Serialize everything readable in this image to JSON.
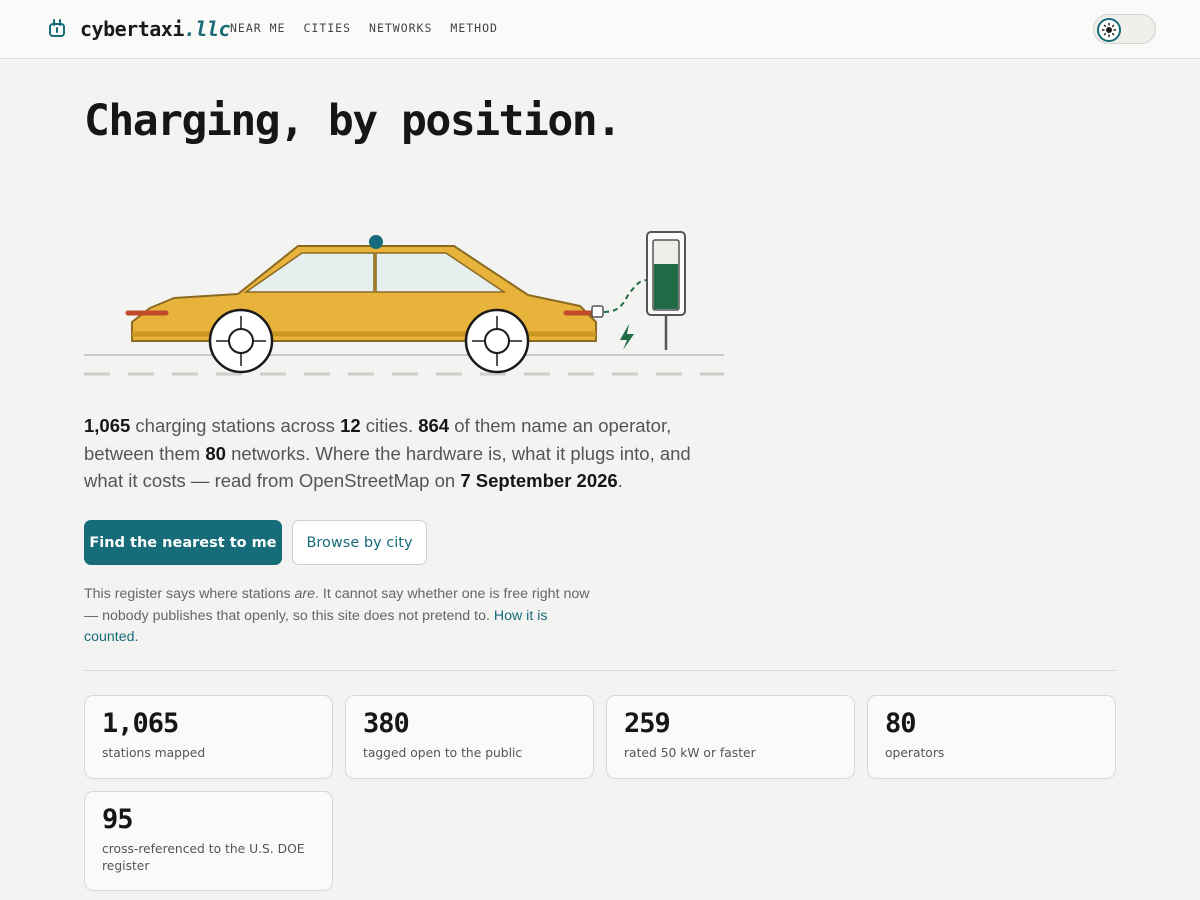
{
  "header": {
    "brand_name": "cybertaxi",
    "brand_tld": ".llc",
    "brand_icon": "plug-icon",
    "nav": [
      "NEAR ME",
      "CITIES",
      "NETWORKS",
      "METHOD"
    ],
    "theme_toggle_icon": "sun-icon"
  },
  "hero": {
    "title": "Charging, by position.",
    "illustration": "taxi-charging-illustration",
    "intro": {
      "stations": "1,065",
      "t1": " charging stations across ",
      "cities": "12",
      "t2": " cities. ",
      "named": "864",
      "t3": " of them name an operator, between them ",
      "networks": "80",
      "t4": " networks. Where the hardware is, what it plugs into, and what it costs — read from OpenStreetMap on ",
      "date": "7 September 2026",
      "t5": "."
    },
    "primary_button": "Find the nearest to me",
    "secondary_button": "Browse by city",
    "caveat": {
      "t1": "This register says where stations ",
      "em": "are",
      "t2": ". It cannot say whether one is free right now — nobody publishes that openly, so this site does not pretend to. ",
      "link": "How it is counted."
    }
  },
  "stats": [
    {
      "value": "1,065",
      "label": "stations mapped"
    },
    {
      "value": "380",
      "label": "tagged open to the public"
    },
    {
      "value": "259",
      "label": "rated 50 kW or faster"
    },
    {
      "value": "80",
      "label": "operators"
    },
    {
      "value": "95",
      "label": "cross-referenced to the U.S. DOE register"
    }
  ],
  "colors": {
    "accent": "#176c79",
    "taxi": "#e8b33a",
    "charge": "#1f6b45",
    "background": "#f3f3f1"
  }
}
